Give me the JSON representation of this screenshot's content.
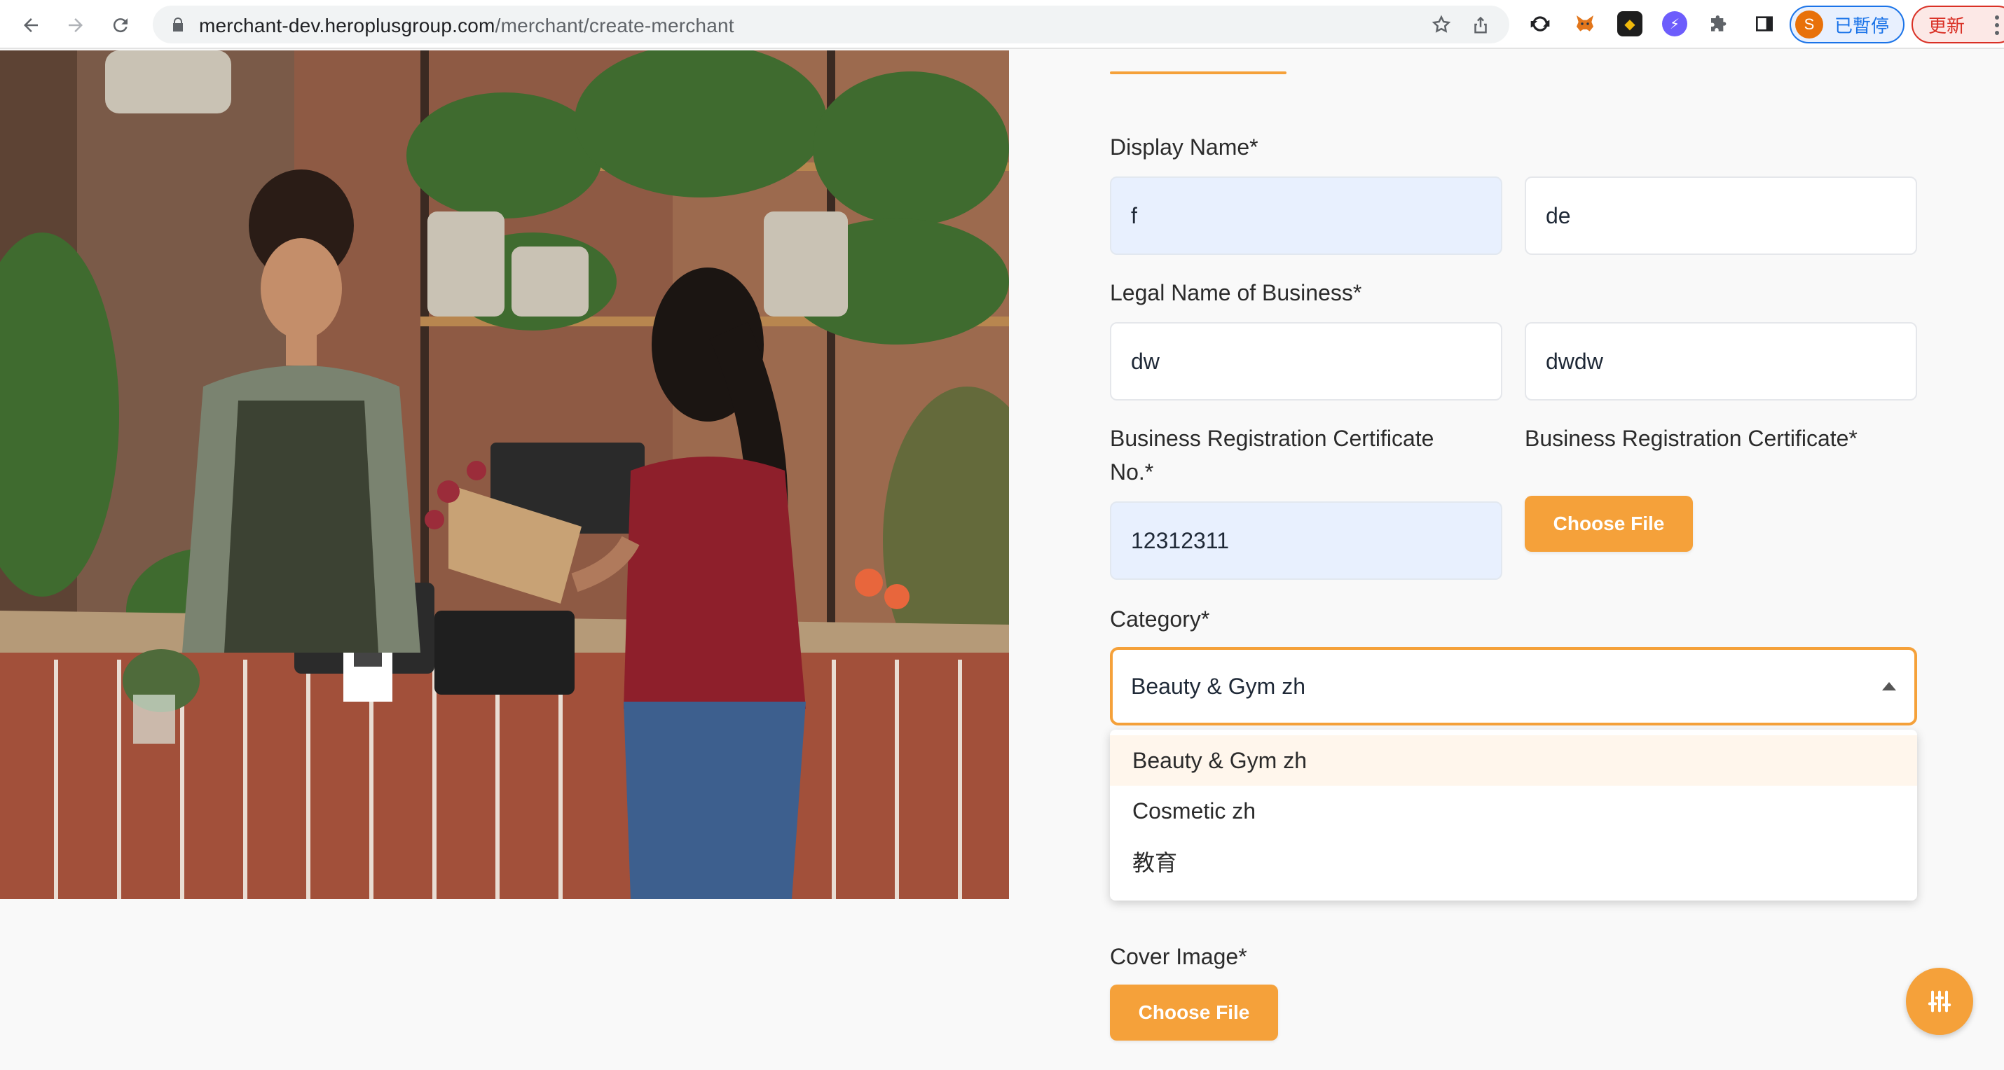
{
  "browser": {
    "url_host": "merchant-dev.heroplusgroup.com",
    "url_path": "/merchant/create-merchant",
    "profile_initial": "S",
    "profile_label": "已暫停",
    "update_label": "更新"
  },
  "form": {
    "display_name": {
      "label": "Display Name*",
      "value_primary": "f",
      "value_secondary": "de"
    },
    "legal_name": {
      "label": "Legal Name of Business*",
      "value_primary": "dw",
      "value_secondary": "dwdw"
    },
    "brc_number": {
      "label_line1": "Business Registration Certificate",
      "label_line2": "No.*",
      "value": "12312311"
    },
    "brc_file": {
      "label": "Business Registration Certificate*",
      "button": "Choose File"
    },
    "category": {
      "label": "Category*",
      "selected": "Beauty & Gym zh",
      "options": [
        "Beauty & Gym zh",
        "Cosmetic zh",
        "教育"
      ]
    },
    "cover_image": {
      "label": "Cover Image*",
      "button": "Choose File"
    }
  },
  "colors": {
    "accent": "#f5a13a",
    "autofill": "#e8f0fe"
  }
}
